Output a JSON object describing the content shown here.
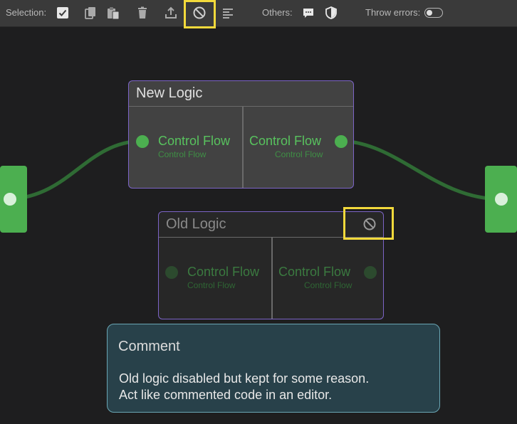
{
  "toolbar": {
    "selection_label": "Selection:",
    "others_label": "Others:",
    "throw_errors_label": "Throw errors:",
    "throw_errors_enabled": false,
    "icons": [
      "checkbox-icon",
      "copy-icon",
      "paste-icon",
      "delete-icon",
      "export-icon",
      "disable-icon",
      "align-icon",
      "comment-icon",
      "shield-icon"
    ],
    "active_icon": "disable-icon"
  },
  "nodes": {
    "new_logic": {
      "title": "New Logic",
      "input": {
        "label": "Control Flow",
        "type": "Control Flow"
      },
      "output": {
        "label": "Control Flow",
        "type": "Control Flow"
      }
    },
    "old_logic": {
      "title": "Old Logic",
      "disabled": true,
      "badge_icon": "disable-icon",
      "input": {
        "label": "Control Flow",
        "type": "Control Flow"
      },
      "output": {
        "label": "Control Flow",
        "type": "Control Flow"
      }
    }
  },
  "comment": {
    "title": "Comment",
    "lines": [
      "Old logic disabled but kept for some reason.",
      "Act like commented code in an editor."
    ]
  },
  "colors": {
    "accent_green": "#4caf50",
    "node_border": "#7c64c7",
    "highlight": "#f2d93b",
    "comment_bg": "#28414a"
  }
}
